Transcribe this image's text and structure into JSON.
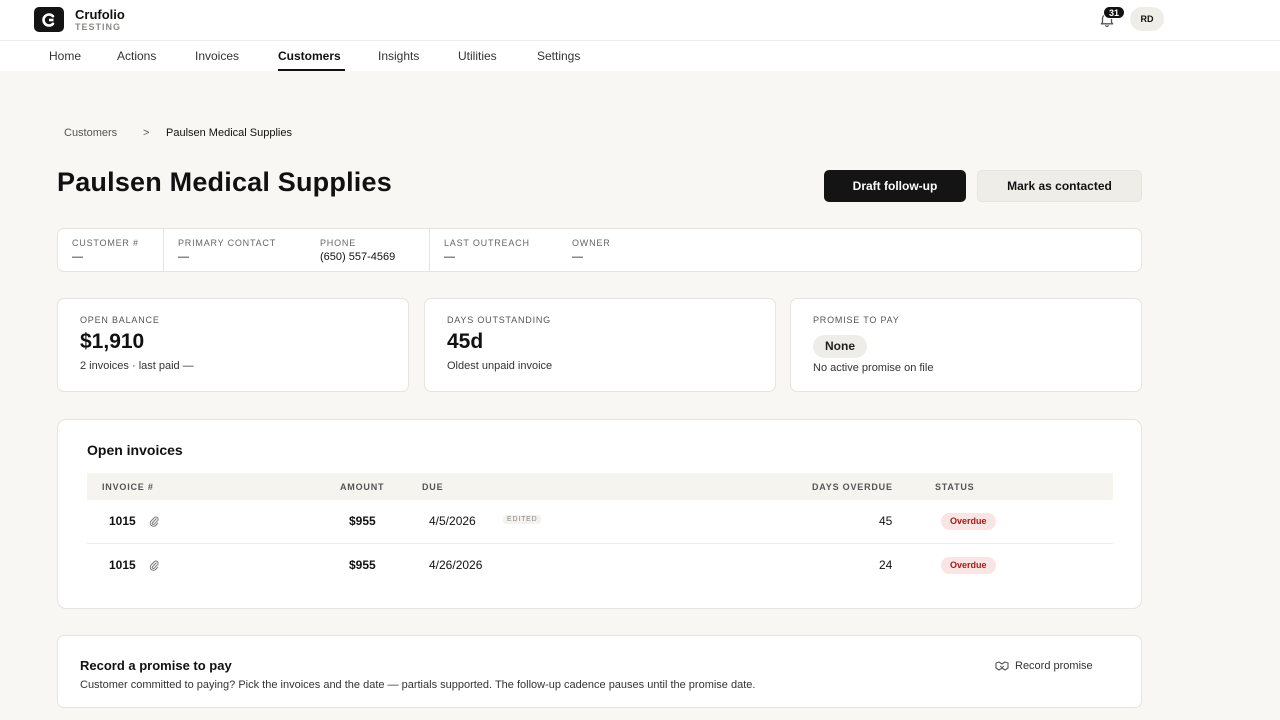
{
  "header": {
    "brand": "Crufolio",
    "env": "TESTING",
    "notifications": "31",
    "avatar": "RD"
  },
  "nav": {
    "items": [
      "Home",
      "Actions",
      "Invoices",
      "Customers",
      "Insights",
      "Utilities",
      "Settings"
    ],
    "active": "Customers"
  },
  "breadcrumb": {
    "parent": "Customers",
    "separator": ">",
    "current": "Paulsen Medical Supplies"
  },
  "customer": {
    "name": "Paulsen Medical Supplies"
  },
  "actions": {
    "draft": "Draft follow-up",
    "contacted": "Mark as contacted"
  },
  "info": {
    "customer_no": {
      "label": "CUSTOMER #",
      "value": "—"
    },
    "primary_contact": {
      "label": "PRIMARY CONTACT",
      "value": "—"
    },
    "phone": {
      "label": "PHONE",
      "value": "(650) 557-4569"
    },
    "last_outreach": {
      "label": "LAST OUTREACH",
      "value": "—"
    },
    "owner": {
      "label": "OWNER",
      "value": "—"
    }
  },
  "stats": {
    "balance": {
      "label": "OPEN BALANCE",
      "value": "$1,910",
      "sub": "2 invoices · last paid —"
    },
    "days": {
      "label": "DAYS OUTSTANDING",
      "value": "45d",
      "sub": "Oldest unpaid invoice"
    },
    "promise": {
      "label": "PROMISE TO PAY",
      "value": "None",
      "sub": "No active promise on file"
    }
  },
  "invoices": {
    "title": "Open invoices",
    "columns": {
      "invoice": "INVOICE #",
      "amount": "AMOUNT",
      "due": "DUE",
      "days_overdue": "DAYS OVERDUE",
      "status": "STATUS"
    },
    "rows": [
      {
        "invoice": "1015",
        "amount": "$955",
        "due": "4/5/2026",
        "tag": "EDITED",
        "days_overdue": "45",
        "status": "Overdue"
      },
      {
        "invoice": "1015",
        "amount": "$955",
        "due": "4/26/2026",
        "tag": "",
        "days_overdue": "24",
        "status": "Overdue"
      }
    ]
  },
  "promise": {
    "title": "Record a promise to pay",
    "description": "Customer committed to paying? Pick the invoices and the date — partials supported. The follow-up cadence pauses until the promise date.",
    "action": "Record promise"
  },
  "icons": {
    "logo": "crufolio-logo-icon",
    "bell": "bell-icon",
    "clip": "paperclip-icon",
    "handshake": "handshake-icon"
  },
  "colors": {
    "primary": "#141414",
    "overdue_bg": "#fbe4e4",
    "overdue_text": "#9b1c1c",
    "page_bg": "#f8f7f4"
  }
}
